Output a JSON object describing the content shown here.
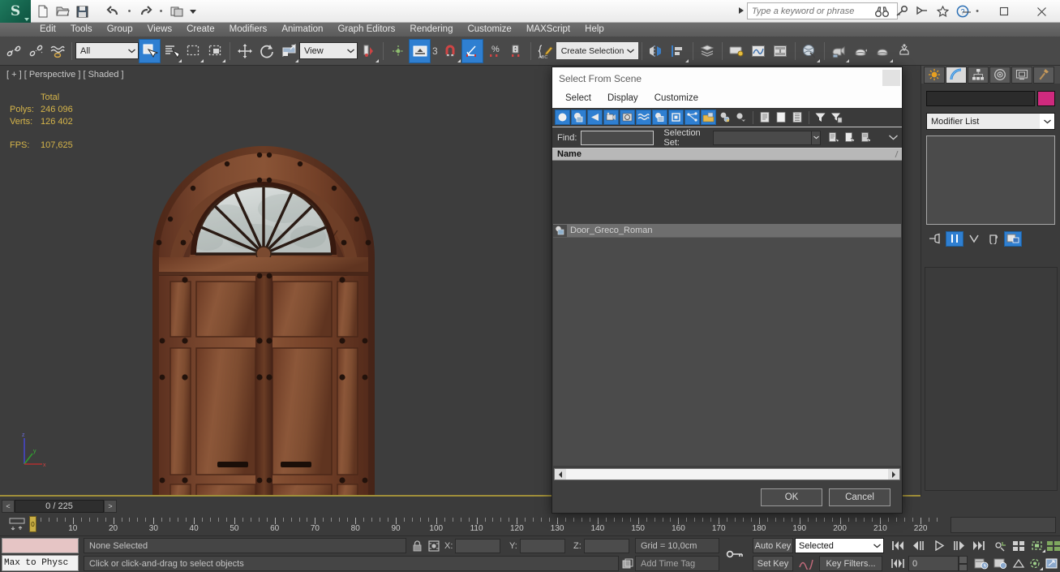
{
  "app": {
    "title_search_placeholder": "Type a keyword or phrase",
    "logo_glyph": "S"
  },
  "quick_access": [
    {
      "name": "new-file",
      "glyph": "new"
    },
    {
      "name": "open-file",
      "glyph": "open"
    },
    {
      "name": "save-file",
      "glyph": "save"
    },
    {
      "name": "undo",
      "glyph": "undo"
    },
    {
      "name": "redo",
      "glyph": "redo"
    },
    {
      "name": "project-folder",
      "glyph": "project"
    }
  ],
  "title_icons": [
    "binoculars-icon",
    "key-icon",
    "lamp-icon",
    "star-icon",
    "help-icon"
  ],
  "window_buttons": [
    "minimize",
    "maximize",
    "close"
  ],
  "menu": {
    "items": [
      "Edit",
      "Tools",
      "Group",
      "Views",
      "Create",
      "Modifiers",
      "Animation",
      "Graph Editors",
      "Rendering",
      "Customize",
      "MAXScript",
      "Help"
    ]
  },
  "toolbar": {
    "selection_filter": "All",
    "reference_coord": "View",
    "named_selection_set": "Create Selection Se",
    "snap_angle": "3",
    "icons": [
      "select-link-icon",
      "unlink-icon",
      "bind-space-warp-icon",
      "select-object-icon",
      "select-by-name-icon",
      "rectangular-region-icon",
      "window-crossing-icon",
      "select-move-icon",
      "select-rotate-icon",
      "select-scale-icon",
      "mirror-icon",
      "align-icon",
      "snaps-toggle-icon",
      "angle-snap-icon",
      "percent-snap-icon",
      "spinner-snap-icon",
      "edit-named-selection-icon",
      "mirror-pivot-icon",
      "align-tool-icon",
      "layer-manager-icon",
      "ribbon-icon",
      "curve-editor-icon",
      "schematic-view-icon",
      "material-editor-icon",
      "render-setup-icon",
      "rendered-frame-icon",
      "render-production-icon",
      "render-iterative-icon"
    ]
  },
  "viewport": {
    "label": "[ + ] [ Perspective ] [ Shaded ]",
    "stats": {
      "header": "Total",
      "rows": [
        {
          "label": "Polys:",
          "value": "246 096"
        },
        {
          "label": "Verts:",
          "value": "126 402"
        }
      ],
      "fps_label": "FPS:",
      "fps_value": "107,625"
    },
    "model": {
      "name": "Door_Greco_Roman",
      "description": "arched paneled wooden door with radial fanlight window"
    },
    "axis_labels": [
      "z",
      "y",
      "x"
    ]
  },
  "command_panel": {
    "tabs": [
      {
        "name": "create-tab",
        "icon": "create-star-icon",
        "selected": false
      },
      {
        "name": "modify-tab",
        "icon": "modify-arc-icon",
        "selected": true
      },
      {
        "name": "hierarchy-tab",
        "icon": "hierarchy-icon",
        "selected": false
      },
      {
        "name": "motion-tab",
        "icon": "motion-icon",
        "selected": false
      },
      {
        "name": "display-tab",
        "icon": "display-icon",
        "selected": false
      },
      {
        "name": "utilities-tab",
        "icon": "utilities-hammer-icon",
        "selected": false
      }
    ],
    "object_name": "",
    "object_color": "#cf2a7e",
    "modifier_list_label": "Modifier List",
    "stack_buttons": [
      "pin-stack-icon",
      "show-end-result-icon",
      "make-unique-icon",
      "remove-modifier-icon",
      "configure-sets-icon"
    ]
  },
  "dialog": {
    "title": "Select From Scene",
    "menu": [
      "Select",
      "Display",
      "Customize"
    ],
    "filter_buttons": [
      {
        "name": "display-geometry-icon",
        "on": true
      },
      {
        "name": "display-shapes-icon",
        "on": true
      },
      {
        "name": "display-lights-icon",
        "on": true
      },
      {
        "name": "display-cameras-icon",
        "on": true
      },
      {
        "name": "display-helpers-icon",
        "on": true
      },
      {
        "name": "display-space-warps-icon",
        "on": true
      },
      {
        "name": "display-groups-icon",
        "on": true
      },
      {
        "name": "display-xrefs-icon",
        "on": true
      },
      {
        "name": "display-bones-icon",
        "on": true
      },
      {
        "name": "display-containers-icon",
        "on": true
      },
      {
        "name": "display-all-icon",
        "on": false
      },
      {
        "name": "display-none-icon",
        "on": false
      },
      {
        "name": "display-children-icon",
        "on": false
      },
      {
        "name": "expand-all-icon",
        "on": false
      },
      {
        "name": "collapse-all-icon",
        "on": false
      },
      {
        "name": "filter-icon",
        "on": false
      },
      {
        "name": "advanced-filter-icon",
        "on": false
      }
    ],
    "find_label": "Find:",
    "find_value": "",
    "selection_set_label": "Selection Set:",
    "selection_set_value": "",
    "column_header": "Name",
    "items": [
      {
        "name": "Door_Greco_Roman",
        "icon": "geometry-object-icon"
      }
    ],
    "ok_label": "OK",
    "cancel_label": "Cancel"
  },
  "timeline": {
    "frame_indicator": "0 / 225",
    "prev_label": "<",
    "next_label": ">",
    "ticks": [
      0,
      10,
      20,
      30,
      40,
      50,
      60,
      70,
      80,
      90,
      100,
      110,
      120,
      130,
      140,
      150,
      160,
      170,
      180,
      190,
      200,
      210,
      220
    ],
    "current_frame": 0,
    "range_max": 225
  },
  "status": {
    "maxscript_label": "Max to Physc",
    "selection_status": "None Selected",
    "prompt": "Click or click-and-drag to select objects",
    "coords": [
      {
        "label": "X:",
        "value": ""
      },
      {
        "label": "Y:",
        "value": ""
      },
      {
        "label": "Z:",
        "value": ""
      }
    ],
    "grid": "Grid = 10,0cm",
    "add_time_tag": "Add Time Tag"
  },
  "animation": {
    "auto_key": "Auto Key",
    "set_key": "Set Key",
    "key_mode": "Selected",
    "key_filters": "Key Filters...",
    "current_frame": "0",
    "playback_icons": [
      "go-to-start-icon",
      "previous-frame-icon",
      "play-icon",
      "next-frame-icon",
      "go-to-end-icon"
    ],
    "view_icons": [
      "pan-icon",
      "zoom-region-icon",
      "zoom-extents-icon",
      "zoom-extents-all-icon",
      "orbit-icon",
      "maximize-viewport-icon"
    ]
  },
  "colors": {
    "accent_blue": "#2f7fd1",
    "viewport_bg": "#3d3d3d",
    "stats_yellow": "#d6b54a",
    "panel_bg": "#3b3b3b",
    "object_color": "#cf2a7e",
    "timeline_thumb": "#c9ae45"
  }
}
